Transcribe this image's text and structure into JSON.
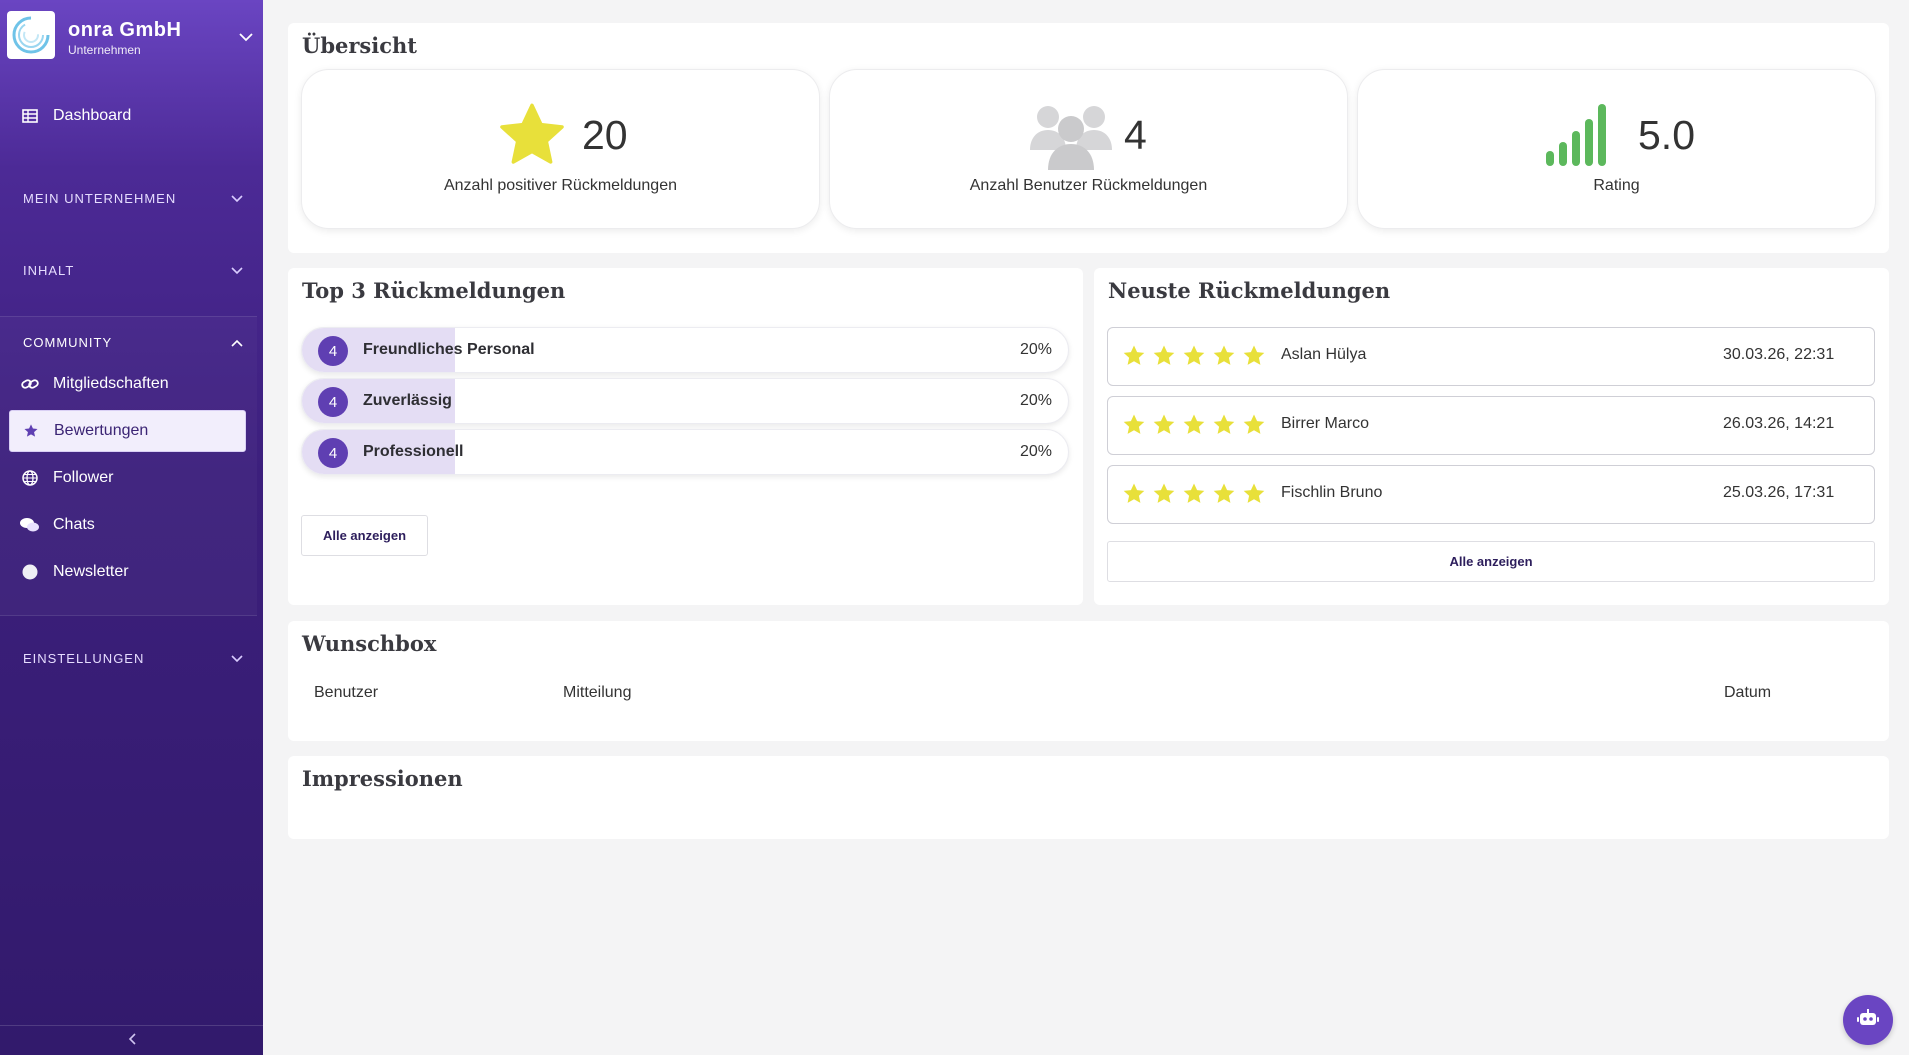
{
  "company": {
    "name": "onra GmbH",
    "subtitle": "Unternehmen"
  },
  "sidebar": {
    "dashboard": "Dashboard",
    "sections": {
      "mein_unternehmen": "MEIN UNTERNEHMEN",
      "inhalt": "INHALT",
      "community": "COMMUNITY",
      "einstellungen": "EINSTELLUNGEN"
    },
    "community_items": [
      {
        "label": "Mitgliedschaften",
        "icon": "link-icon"
      },
      {
        "label": "Bewertungen",
        "icon": "star-icon",
        "active": true
      },
      {
        "label": "Follower",
        "icon": "globe-icon"
      },
      {
        "label": "Chats",
        "icon": "chat-icon"
      },
      {
        "label": "Newsletter",
        "icon": "circle-icon"
      }
    ]
  },
  "overview": {
    "title": "Übersicht",
    "stats": [
      {
        "value": "20",
        "label": "Anzahl positiver Rückmeldungen",
        "icon": "star-icon"
      },
      {
        "value": "4",
        "label": "Anzahl Benutzer Rückmeldungen",
        "icon": "users-icon"
      },
      {
        "value": "5.0",
        "label": "Rating",
        "icon": "signal-bars-icon"
      }
    ]
  },
  "top3": {
    "title": "Top 3 Rückmeldungen",
    "items": [
      {
        "count": "4",
        "label": "Freundliches Personal",
        "percent": "20%",
        "fill": 0.2
      },
      {
        "count": "4",
        "label": "Zuverlässig",
        "percent": "20%",
        "fill": 0.2
      },
      {
        "count": "4",
        "label": "Professionell",
        "percent": "20%",
        "fill": 0.2
      }
    ],
    "show_all": "Alle anzeigen"
  },
  "latest": {
    "title": "Neuste Rückmeldungen",
    "reviews": [
      {
        "name": "Aslan Hülya",
        "date": "30.03.26, 22:31",
        "stars": 5
      },
      {
        "name": "Birrer Marco",
        "date": "26.03.26, 14:21",
        "stars": 5
      },
      {
        "name": "Fischlin Bruno",
        "date": "25.03.26, 17:31",
        "stars": 5
      }
    ],
    "show_all": "Alle anzeigen"
  },
  "wishbox": {
    "title": "Wunschbox",
    "columns": [
      "Benutzer",
      "Mitteilung",
      "Datum"
    ]
  },
  "impressions": {
    "title": "Impressionen"
  },
  "colors": {
    "accent": "#5f3fb2",
    "star": "#e8e03a",
    "signal": "#5cb85c"
  }
}
